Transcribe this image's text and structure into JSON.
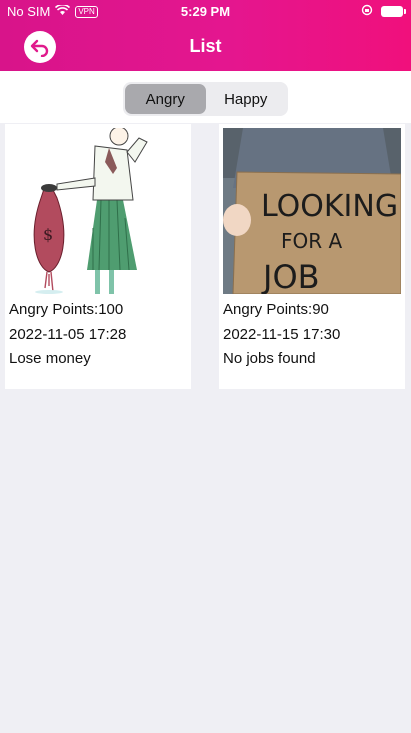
{
  "status_bar": {
    "carrier": "No SIM",
    "vpn": "VPN",
    "time": "5:29 PM"
  },
  "nav": {
    "title": "List"
  },
  "tabs": [
    {
      "label": "Angry",
      "active": true
    },
    {
      "label": "Happy",
      "active": false
    }
  ],
  "items": [
    {
      "points": "Angry Points:100",
      "date": "2022-11-05 17:28",
      "reason": "Lose money",
      "image_icon": "woman-holding-money-bag-illustration"
    },
    {
      "points": "Angry Points:90",
      "date": "2022-11-15 17:30",
      "reason": "No jobs found",
      "image_icon": "man-holding-sign-photo",
      "sign_text": [
        "LOOKING",
        "FOR A",
        "JOB"
      ]
    }
  ],
  "colors": {
    "header_start": "#d8148a",
    "header_end": "#f0107c",
    "background": "#efeff4"
  }
}
